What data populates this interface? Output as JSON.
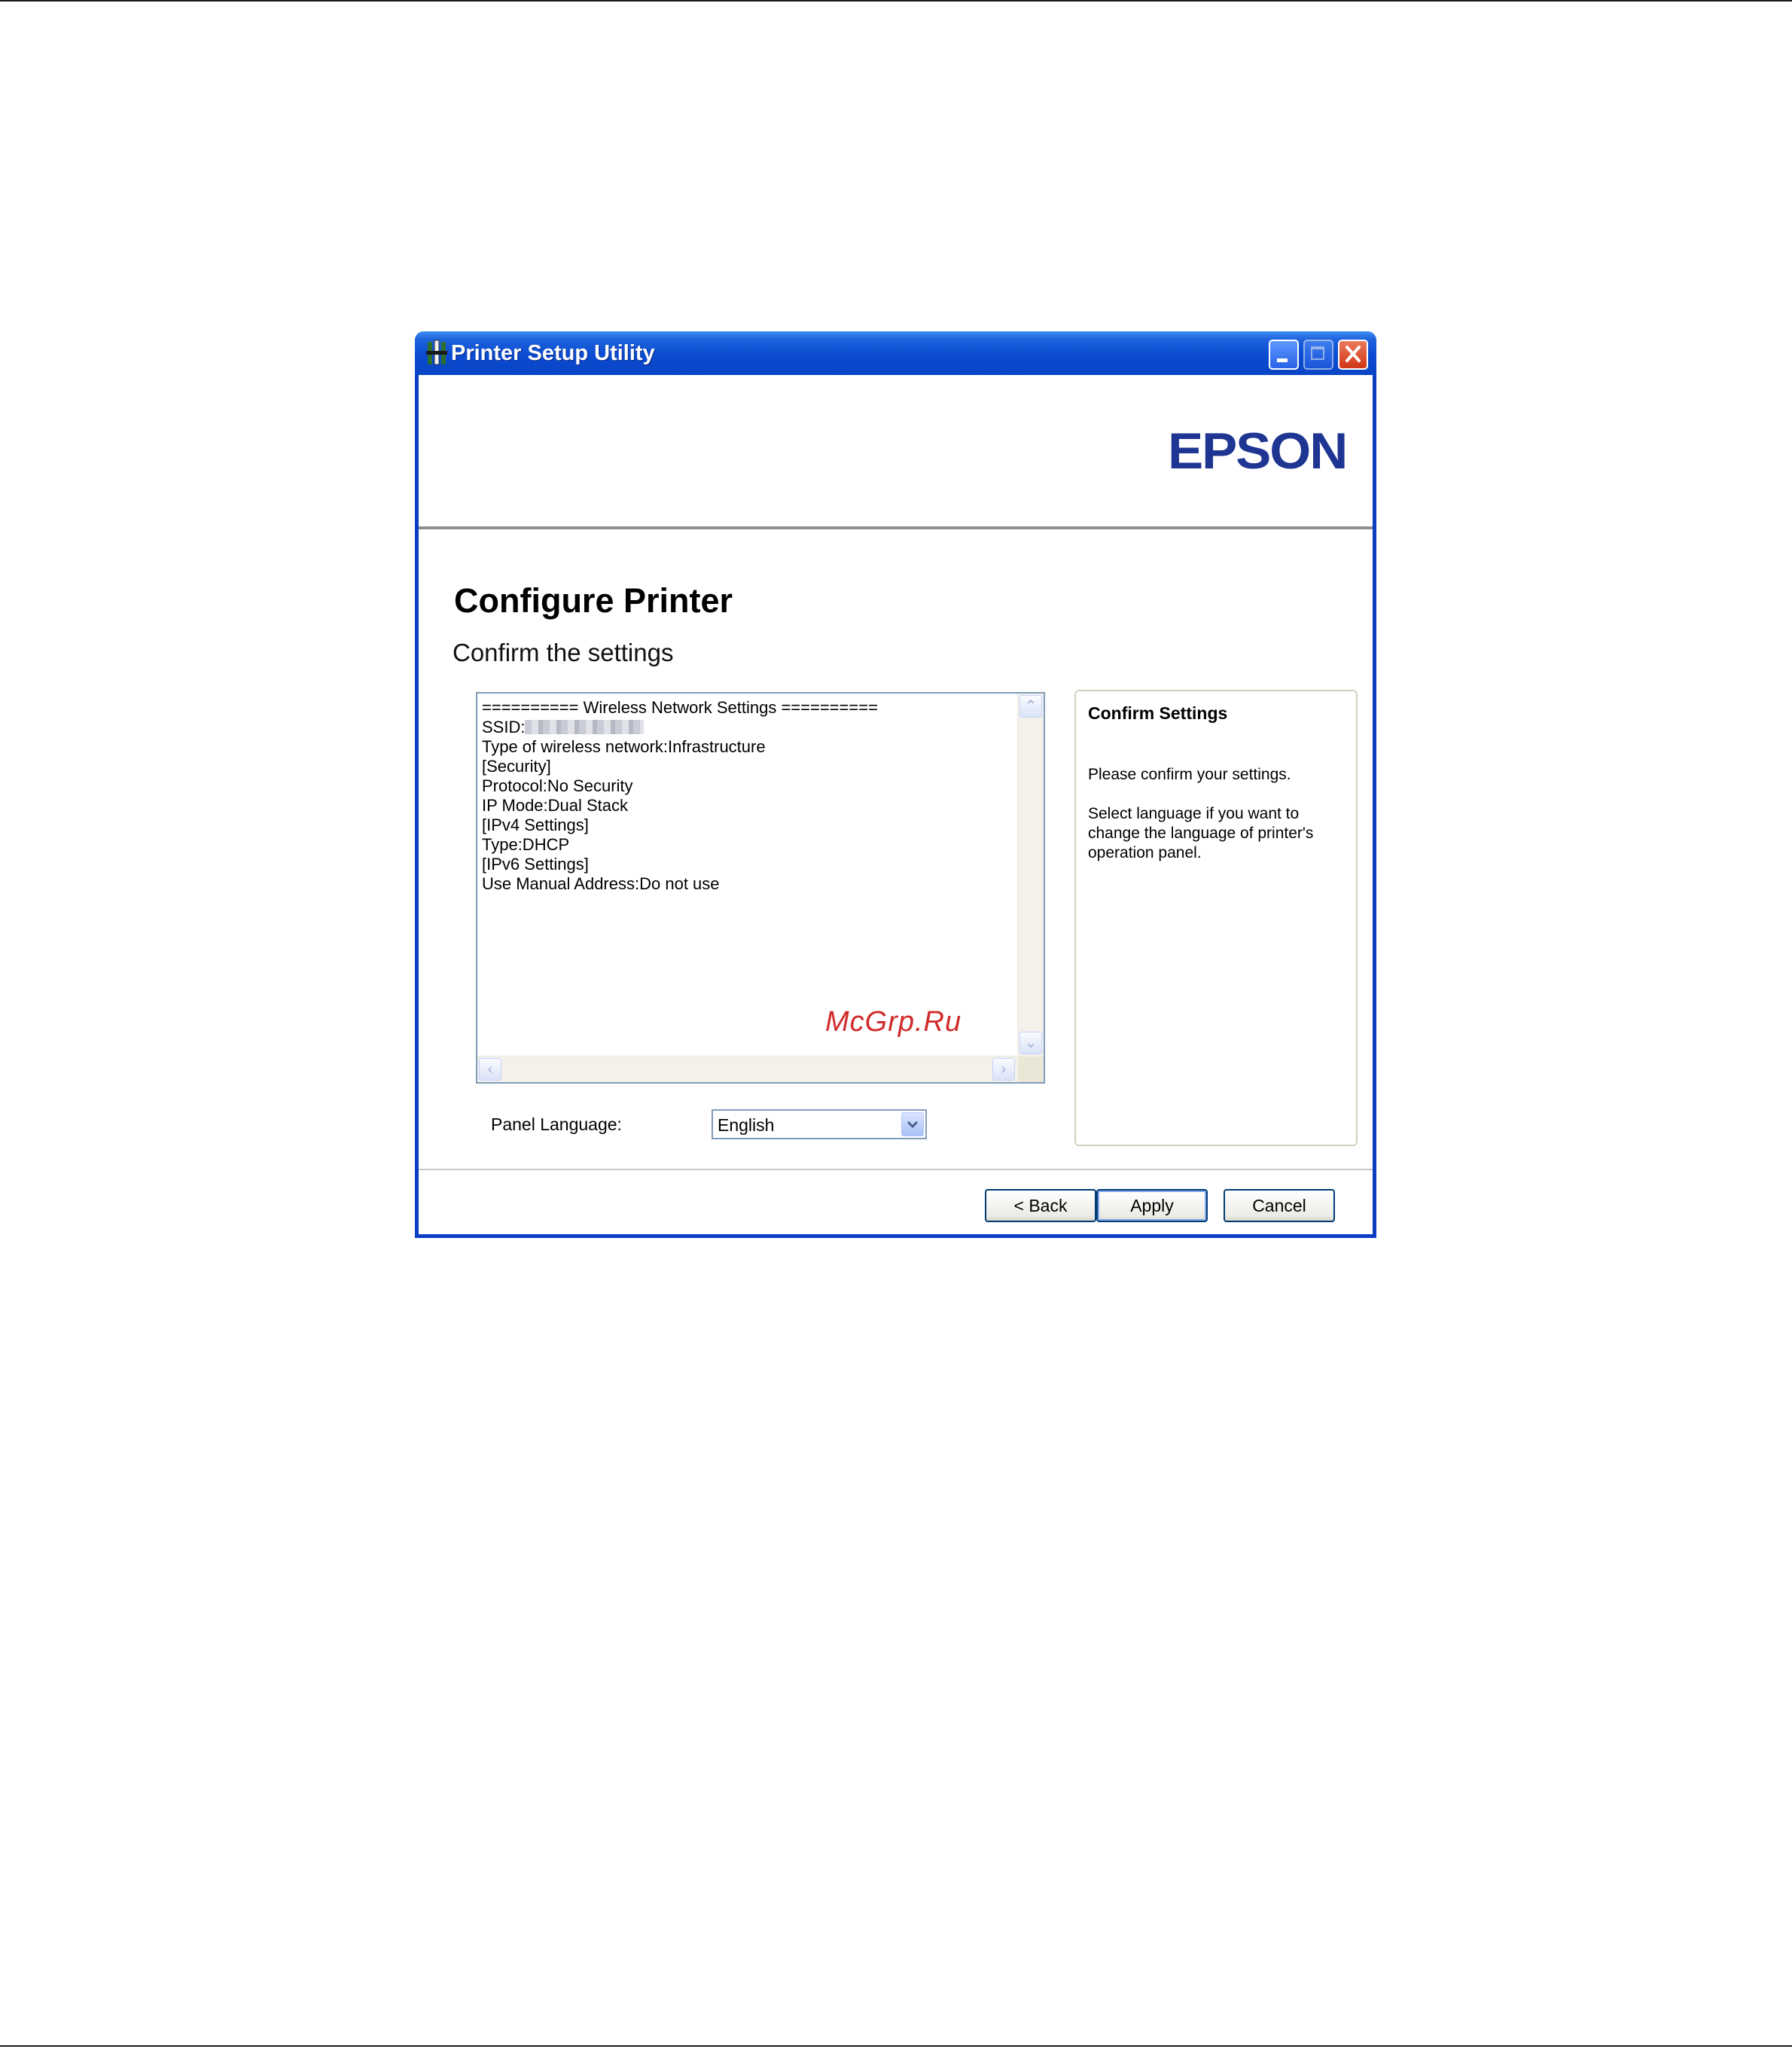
{
  "window": {
    "title": "Printer Setup Utility"
  },
  "brand": {
    "logo_text": "EPSON",
    "logo_color": "#1f3592"
  },
  "page": {
    "title": "Configure Printer",
    "subtitle": "Confirm the settings"
  },
  "settings": {
    "lines": [
      "========== Wireless Network Settings ==========",
      "SSID:",
      "Type of wireless network:Infrastructure",
      "[Security]",
      "Protocol:No Security",
      "IP Mode:Dual Stack",
      "[IPv4 Settings]",
      "Type:DHCP",
      "[IPv6 Settings]",
      "Use Manual Address:Do not use"
    ]
  },
  "help": {
    "title": "Confirm Settings",
    "paragraph1": "Please confirm your settings.",
    "paragraph2": "Select language if you want to change the language of printer's operation panel."
  },
  "panel_language": {
    "label": "Panel Language:",
    "selected": "English"
  },
  "buttons": {
    "back": "< Back",
    "apply": "Apply",
    "cancel": "Cancel"
  },
  "watermark": "McGrp.Ru",
  "colors": {
    "titlebar": "#0a4bd1",
    "close_button": "#cf3616",
    "watermark": "#d02b2b"
  }
}
